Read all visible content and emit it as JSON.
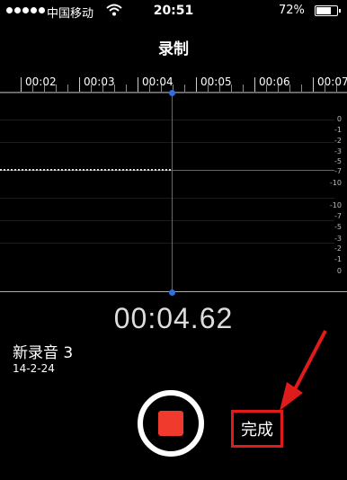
{
  "status_bar": {
    "carrier": "中国移动",
    "time": "20:51",
    "battery": "72%"
  },
  "title": "录制",
  "timeline": [
    "00:02",
    "00:03",
    "00:04",
    "00:05",
    "00:06",
    "00:07"
  ],
  "db_scale_top": [
    "0",
    "-1",
    "-2",
    "-3",
    "-5",
    "-7",
    "-10"
  ],
  "db_scale_bottom": [
    "-10",
    "-7",
    "-5",
    "-3",
    "-2",
    "-1",
    "0"
  ],
  "elapsed_time": "00:04.62",
  "recording": {
    "name": "新录音 3",
    "date": "14-2-24"
  },
  "done_label": "完成",
  "colors": {
    "playhead": "#2f6fe0",
    "record_stop": "#f03a2e",
    "highlight": "#e01b1b"
  }
}
